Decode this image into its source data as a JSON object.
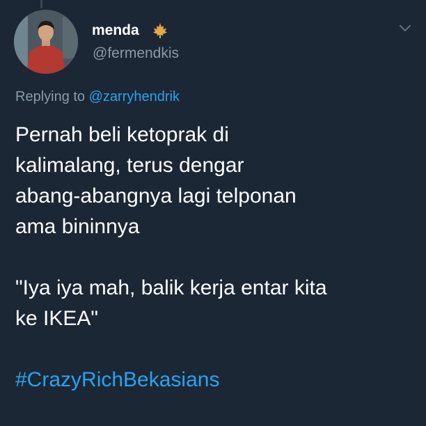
{
  "author": {
    "display_name": "menda",
    "handle": "@fermendkis",
    "badge_icon": "maple-leaf-icon",
    "badge_color": "#e8a64a"
  },
  "menu": {
    "icon": "chevron-down-icon"
  },
  "reply": {
    "prefix": "Replying to",
    "target": "@zarryhendrik"
  },
  "tweet": {
    "paragraph_1": "Pernah beli ketoprak di\nkalimalang, terus dengar\nabang-abangnya lagi telponan\nama bininnya",
    "paragraph_2": "\"Iya iya mah, balik kerja entar kita\nke IKEA\"",
    "hashtag": "#CrazyRichBekasians"
  },
  "colors": {
    "background": "#1b2735",
    "link": "#2aa3ef",
    "muted_text": "#8a9aa9"
  }
}
